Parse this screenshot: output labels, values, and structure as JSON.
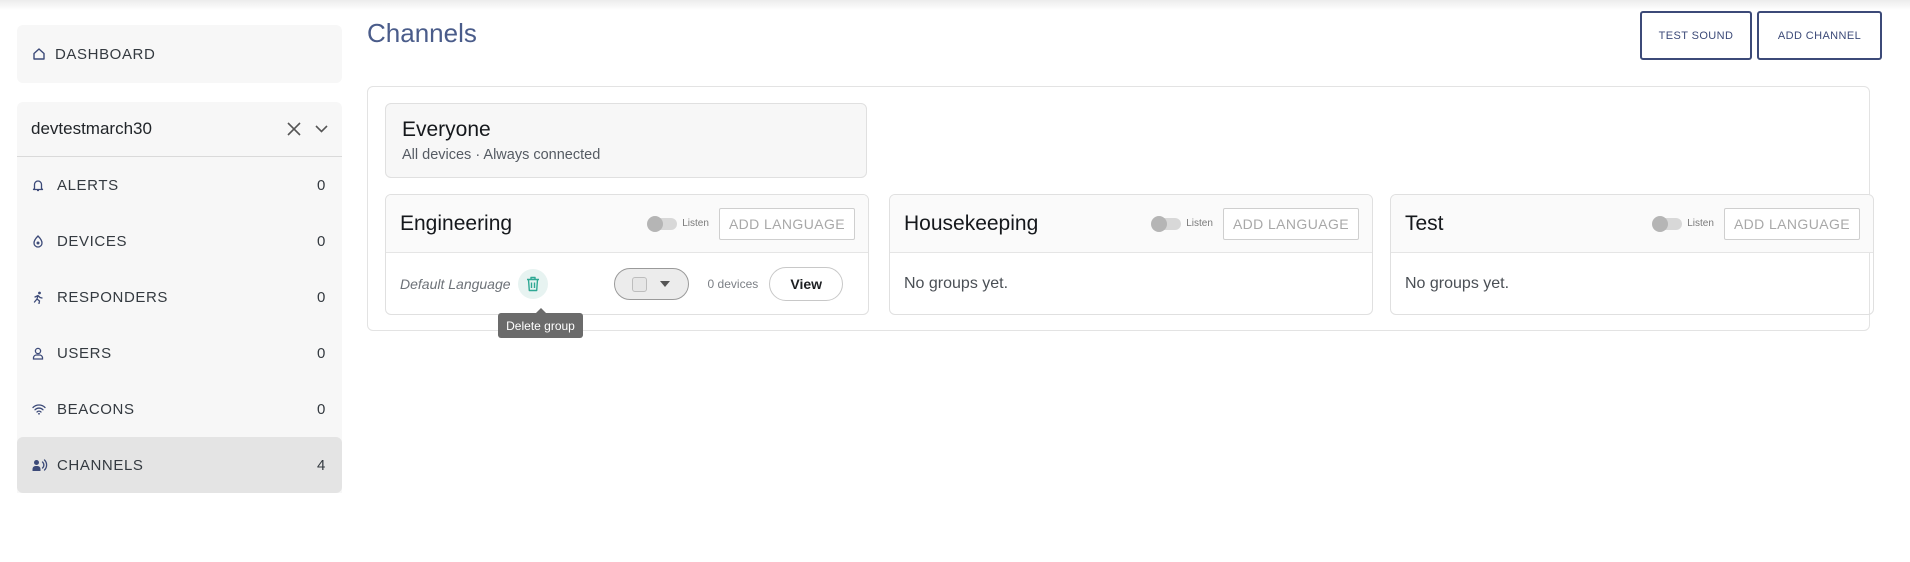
{
  "sidebar": {
    "dashboard_label": "DASHBOARD",
    "org_name": "devtestmarch30",
    "items": [
      {
        "label": "ALERTS",
        "count": "0",
        "icon": "bell-icon"
      },
      {
        "label": "DEVICES",
        "count": "0",
        "icon": "device-icon"
      },
      {
        "label": "RESPONDERS",
        "count": "0",
        "icon": "runner-icon"
      },
      {
        "label": "USERS",
        "count": "0",
        "icon": "user-icon"
      },
      {
        "label": "BEACONS",
        "count": "0",
        "icon": "wifi-icon"
      },
      {
        "label": "CHANNELS",
        "count": "4",
        "icon": "speaker-person-icon",
        "active": true
      }
    ]
  },
  "header": {
    "title": "Channels",
    "test_sound_label": "TEST SOUND",
    "add_channel_label": "ADD CHANNEL"
  },
  "everyone": {
    "title": "Everyone",
    "subtitle": "All devices · Always connected"
  },
  "channels": [
    {
      "name": "Engineering",
      "listen_label": "Listen",
      "add_language_label": "ADD LANGUAGE",
      "group": {
        "language": "Default Language",
        "devices": "0 devices",
        "view_label": "View"
      }
    },
    {
      "name": "Housekeeping",
      "listen_label": "Listen",
      "add_language_label": "ADD LANGUAGE",
      "empty_text": "No groups yet."
    },
    {
      "name": "Test",
      "listen_label": "Listen",
      "add_language_label": "ADD LANGUAGE",
      "empty_text": "No groups yet."
    }
  ],
  "tooltip": {
    "text": "Delete group"
  },
  "colors": {
    "primary": "#3c4a78",
    "title": "#4a5c8a",
    "sidebar_bg": "#f7f7f7",
    "active_bg": "#e4e4e4",
    "trash_accent": "#2fa894"
  }
}
